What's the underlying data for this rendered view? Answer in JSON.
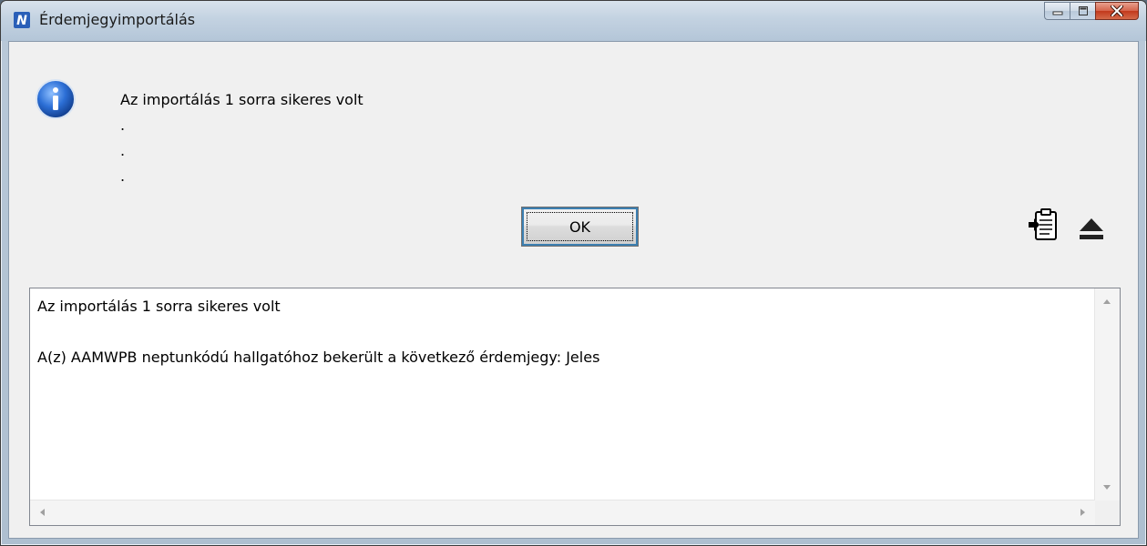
{
  "window": {
    "title": "Érdemjegyimportálás",
    "app_icon": "neptun-n-icon"
  },
  "caption_buttons": {
    "minimize": "minimize-icon",
    "maximize": "maximize-icon",
    "close": "close-icon"
  },
  "message": {
    "icon": "info-icon",
    "lines": [
      "Az importálás 1 sorra sikeres volt",
      ".",
      ".",
      "."
    ]
  },
  "ok_button": {
    "label": "OK"
  },
  "toolbar": {
    "paste_icon": "paste-clipboard-icon",
    "collapse_icon": "eject-icon"
  },
  "log": {
    "lines": [
      "Az importálás 1 sorra sikeres volt",
      "",
      "A(z) AAMWPB neptunkódú hallgatóhoz bekerült a következő érdemjegy: Jeles"
    ]
  },
  "colors": {
    "info_blue": "#1f5fbf",
    "close_red": "#c2391c"
  }
}
